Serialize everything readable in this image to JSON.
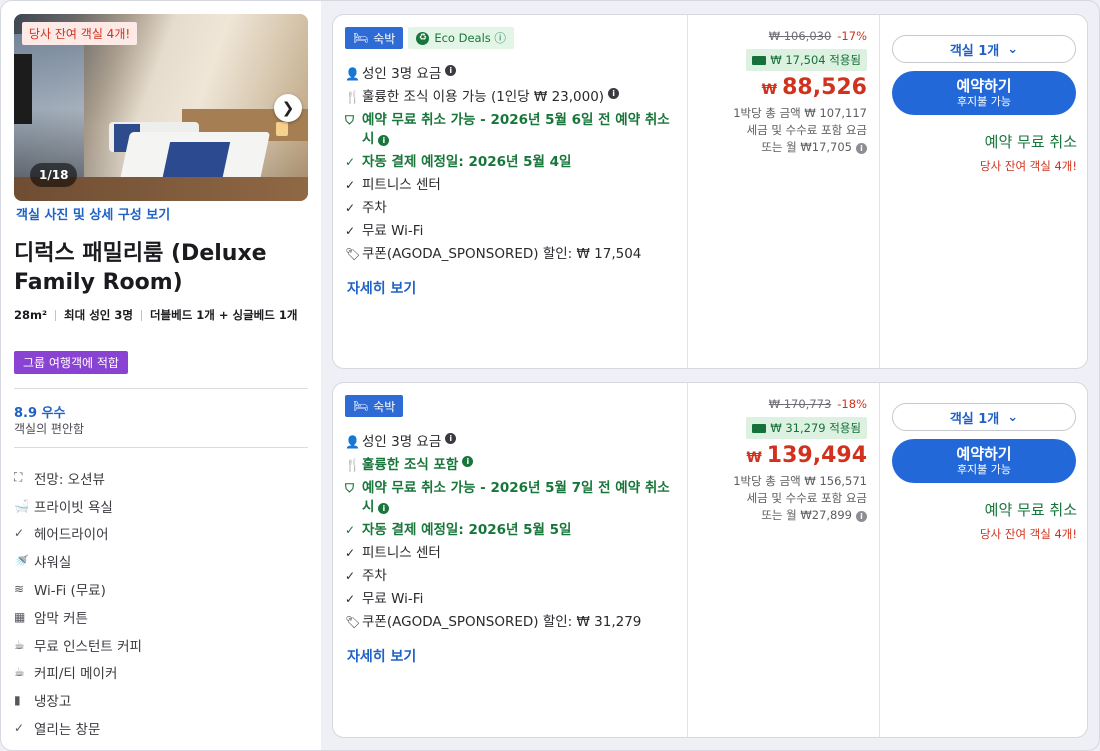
{
  "room": {
    "photo_badge": "당사 잔여 객실 4개!",
    "photo_counter": "1/18",
    "photo_link": "객실 사진 및 상세 구성 보기",
    "title": "디럭스 패밀리룸 (Deluxe Family Room)",
    "size": "28m²",
    "occupancy": "최대 성인 3명",
    "beds": "더블베드 1개 + 싱글베드 1개",
    "group_tag": "그룹 여행객에 적합",
    "rating_score": "8.9 우수",
    "rating_sub": "객실의 편안함",
    "amenities": [
      {
        "icon": "view-icon",
        "glyph": "⛶",
        "label": "전망: 오션뷰"
      },
      {
        "icon": "bathtub-icon",
        "glyph": "🛁",
        "label": "프라이빗 욕실"
      },
      {
        "icon": "check-icon",
        "glyph": "✓",
        "label": "헤어드라이어"
      },
      {
        "icon": "shower-icon",
        "glyph": "🚿",
        "label": "샤워실"
      },
      {
        "icon": "wifi-icon",
        "glyph": "≋",
        "label": "Wi-Fi (무료)"
      },
      {
        "icon": "curtain-icon",
        "glyph": "▦",
        "label": "암막 커튼"
      },
      {
        "icon": "coffee-machine-icon",
        "glyph": "☕",
        "label": "무료 인스턴트 커피"
      },
      {
        "icon": "kettle-icon",
        "glyph": "☕",
        "label": "커피/티 메이커"
      },
      {
        "icon": "fridge-icon",
        "glyph": "▮",
        "label": "냉장고"
      },
      {
        "icon": "check-icon",
        "glyph": "✓",
        "label": "열리는 창문"
      }
    ]
  },
  "offers": [
    {
      "stay_tag": "숙박",
      "eco_tag": "Eco Deals ⓘ",
      "features": {
        "guests": "성인 3명 요금",
        "breakfast": "훌륭한 조식 이용 가능 (1인당 ₩ 23,000)",
        "cancel": "예약 무료 취소 가능 - 2026년 5월 6일 전 예약 취소 시",
        "autopay": "자동 결제 예정일: 2026년 5월 4일",
        "fitness": "피트니스 센터",
        "parking": "주차",
        "wifi": "무료 Wi-Fi",
        "coupon": "쿠폰(AGODA_SPONSORED) 할인: ₩ 17,504"
      },
      "more_link": "자세히 보기",
      "original_price": "₩ 106,030",
      "discount_pct": "-17%",
      "saving_label": "₩ 17,504 적용됨",
      "currency": "₩",
      "final_price": "88,526",
      "total_line": "1박당 총 금액 ₩ 107,117",
      "tax_line": "세금 및 수수료 포함 요금",
      "monthly_line": "또는 월 ₩17,705",
      "qty_label": "객실 1개",
      "book_label": "예약하기",
      "book_sub": "후지불 가능",
      "free_cancel": "예약 무료 취소",
      "rooms_left": "당사 잔여 객실 4개!"
    },
    {
      "stay_tag": "숙박",
      "features": {
        "guests": "성인 3명 요금",
        "breakfast": "훌륭한 조식 포함",
        "cancel": "예약 무료 취소 가능 - 2026년 5월 7일 전 예약 취소 시",
        "autopay": "자동 결제 예정일: 2026년 5월 5일",
        "fitness": "피트니스 센터",
        "parking": "주차",
        "wifi": "무료 Wi-Fi",
        "coupon": "쿠폰(AGODA_SPONSORED) 할인: ₩ 31,279"
      },
      "more_link": "자세히 보기",
      "original_price": "₩ 170,773",
      "discount_pct": "-18%",
      "saving_label": "₩ 31,279 적용됨",
      "currency": "₩",
      "final_price": "139,494",
      "total_line": "1박당 총 금액 ₩ 156,571",
      "tax_line": "세금 및 수수료 포함 요금",
      "monthly_line": "또는 월 ₩27,899",
      "qty_label": "객실 1개",
      "book_label": "예약하기",
      "book_sub": "후지불 가능",
      "free_cancel": "예약 무료 취소",
      "rooms_left": "당사 잔여 객실 4개!"
    }
  ],
  "colors": {
    "accent_blue": "#2268d9",
    "price_red": "#d0321e",
    "green": "#18763a",
    "group_purple": "#8a42d3"
  }
}
